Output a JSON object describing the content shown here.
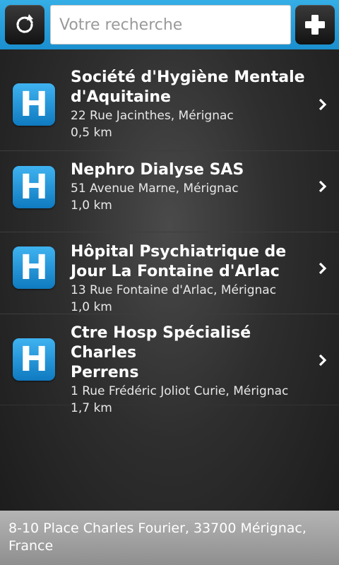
{
  "toolbar": {
    "refresh_icon": "refresh-icon",
    "add_icon": "plus-icon",
    "search_placeholder": "Votre recherche",
    "accent_color": "#1b8fcf"
  },
  "results": [
    {
      "icon_letter": "H",
      "title_line1": "Société d'Hygiène Mentale",
      "title_line2": "d'Aquitaine",
      "address": "22 Rue Jacinthes, Mérignac",
      "distance": "0,5 km"
    },
    {
      "icon_letter": "H",
      "title_line1": "Nephro Dialyse SAS",
      "title_line2": "",
      "address": "51 Avenue Marne, Mérignac",
      "distance": "1,0 km"
    },
    {
      "icon_letter": "H",
      "title_line1": "Hôpital Psychiatrique de",
      "title_line2": "Jour La Fontaine d'Arlac",
      "address": "13 Rue Fontaine d'Arlac, Mérignac",
      "distance": "1,0 km"
    },
    {
      "icon_letter": "H",
      "title_line1": "Ctre Hosp Spécialisé Charles",
      "title_line2": "Perrens",
      "address": "1 Rue Frédéric Joliot Curie, Mérignac",
      "distance": "1,7 km"
    }
  ],
  "footer": {
    "location_line1": "8-10 Place Charles Fourier, 33700 Mérignac,",
    "location_line2": "France"
  }
}
